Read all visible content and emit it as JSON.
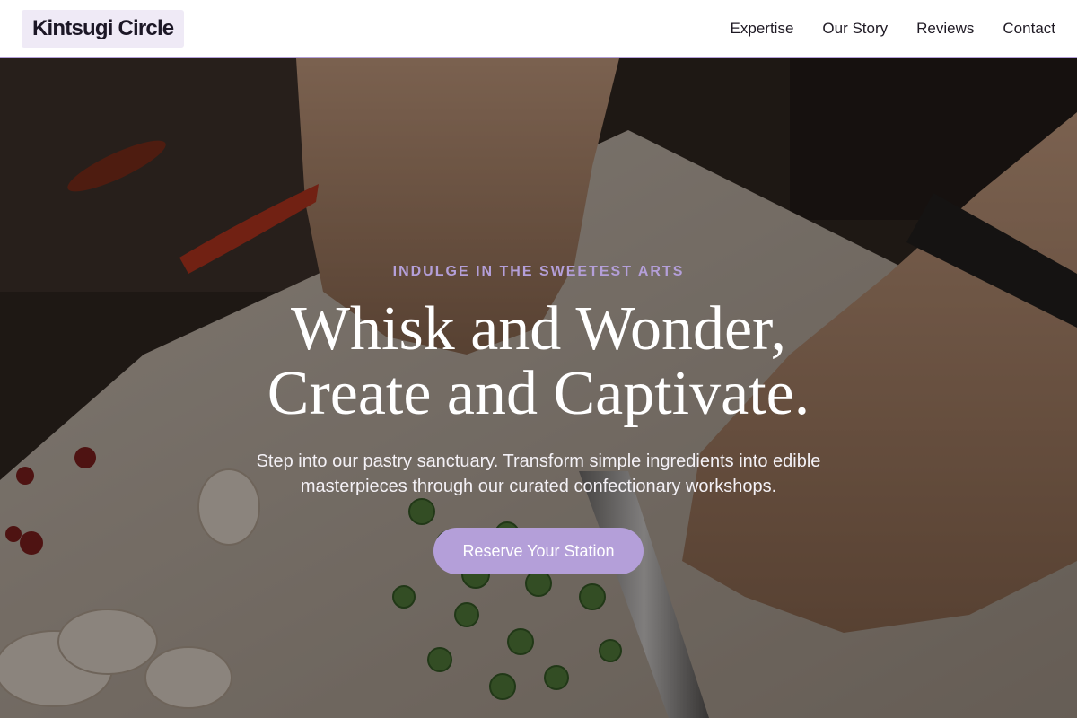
{
  "brand": {
    "name": "Kintsugi Circle"
  },
  "nav": {
    "links": [
      "Expertise",
      "Our Story",
      "Reviews",
      "Contact"
    ]
  },
  "hero": {
    "eyebrow": "INDULGE IN THE SWEETEST ARTS",
    "headline_line1": "Whisk and Wonder,",
    "headline_line2": "Create and Captivate.",
    "subtext": "Step into our pastry sanctuary. Transform simple ingredients into edible masterpieces through our curated confectionary workshops.",
    "cta_label": "Reserve Your Station",
    "background_image": "chef-slicing-vegetables-photo"
  },
  "colors": {
    "accent": "#b49fd9",
    "nav_background": "#ffffff",
    "text_dark": "#1f1a24",
    "logo_background": "#efeaf6"
  }
}
